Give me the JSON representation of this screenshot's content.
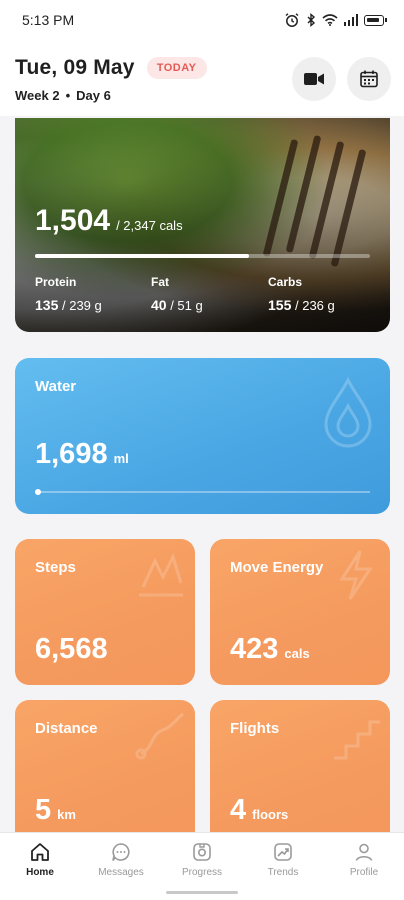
{
  "status_bar": {
    "time": "5:13 PM",
    "icons": [
      "alarm-icon",
      "bluetooth-icon",
      "wifi-icon",
      "signal-icon",
      "battery-icon"
    ]
  },
  "header": {
    "date": "Tue, 09 May",
    "today_badge": "TODAY",
    "week": "Week 2",
    "day": "Day 6",
    "separator": "•",
    "buttons": [
      "video-camera-icon",
      "calendar-icon"
    ]
  },
  "nutrition": {
    "calories_consumed": "1,504",
    "calories_goal": "/ 2,347 cals",
    "progress": 0.64,
    "macros": [
      {
        "label": "Protein",
        "value": "135",
        "goal": "/ 239 g"
      },
      {
        "label": "Fat",
        "value": "40",
        "goal": "/ 51 g"
      },
      {
        "label": "Carbs",
        "value": "155",
        "goal": "/ 236 g"
      }
    ]
  },
  "water": {
    "title": "Water",
    "value": "1,698",
    "unit": "ml",
    "progress": 0.02
  },
  "tiles": [
    {
      "title": "Steps",
      "value": "6,568",
      "unit": ""
    },
    {
      "title": "Move Energy",
      "value": "423",
      "unit": "cals"
    },
    {
      "title": "Distance",
      "value": "5",
      "unit": "km"
    },
    {
      "title": "Flights",
      "value": "4",
      "unit": "floors"
    }
  ],
  "tab_bar": {
    "tabs": [
      {
        "label": "Home",
        "icon": "home-icon",
        "active": true
      },
      {
        "label": "Messages",
        "icon": "messages-icon",
        "active": false
      },
      {
        "label": "Progress",
        "icon": "progress-icon",
        "active": false
      },
      {
        "label": "Trends",
        "icon": "trends-icon",
        "active": false
      },
      {
        "label": "Profile",
        "icon": "profile-icon",
        "active": false
      }
    ]
  },
  "colors": {
    "today_badge_bg": "#fde7e6",
    "today_badge_text": "#e45a55",
    "water_card": "#4aa6e3",
    "activity_tiles": "#f59b5f"
  }
}
